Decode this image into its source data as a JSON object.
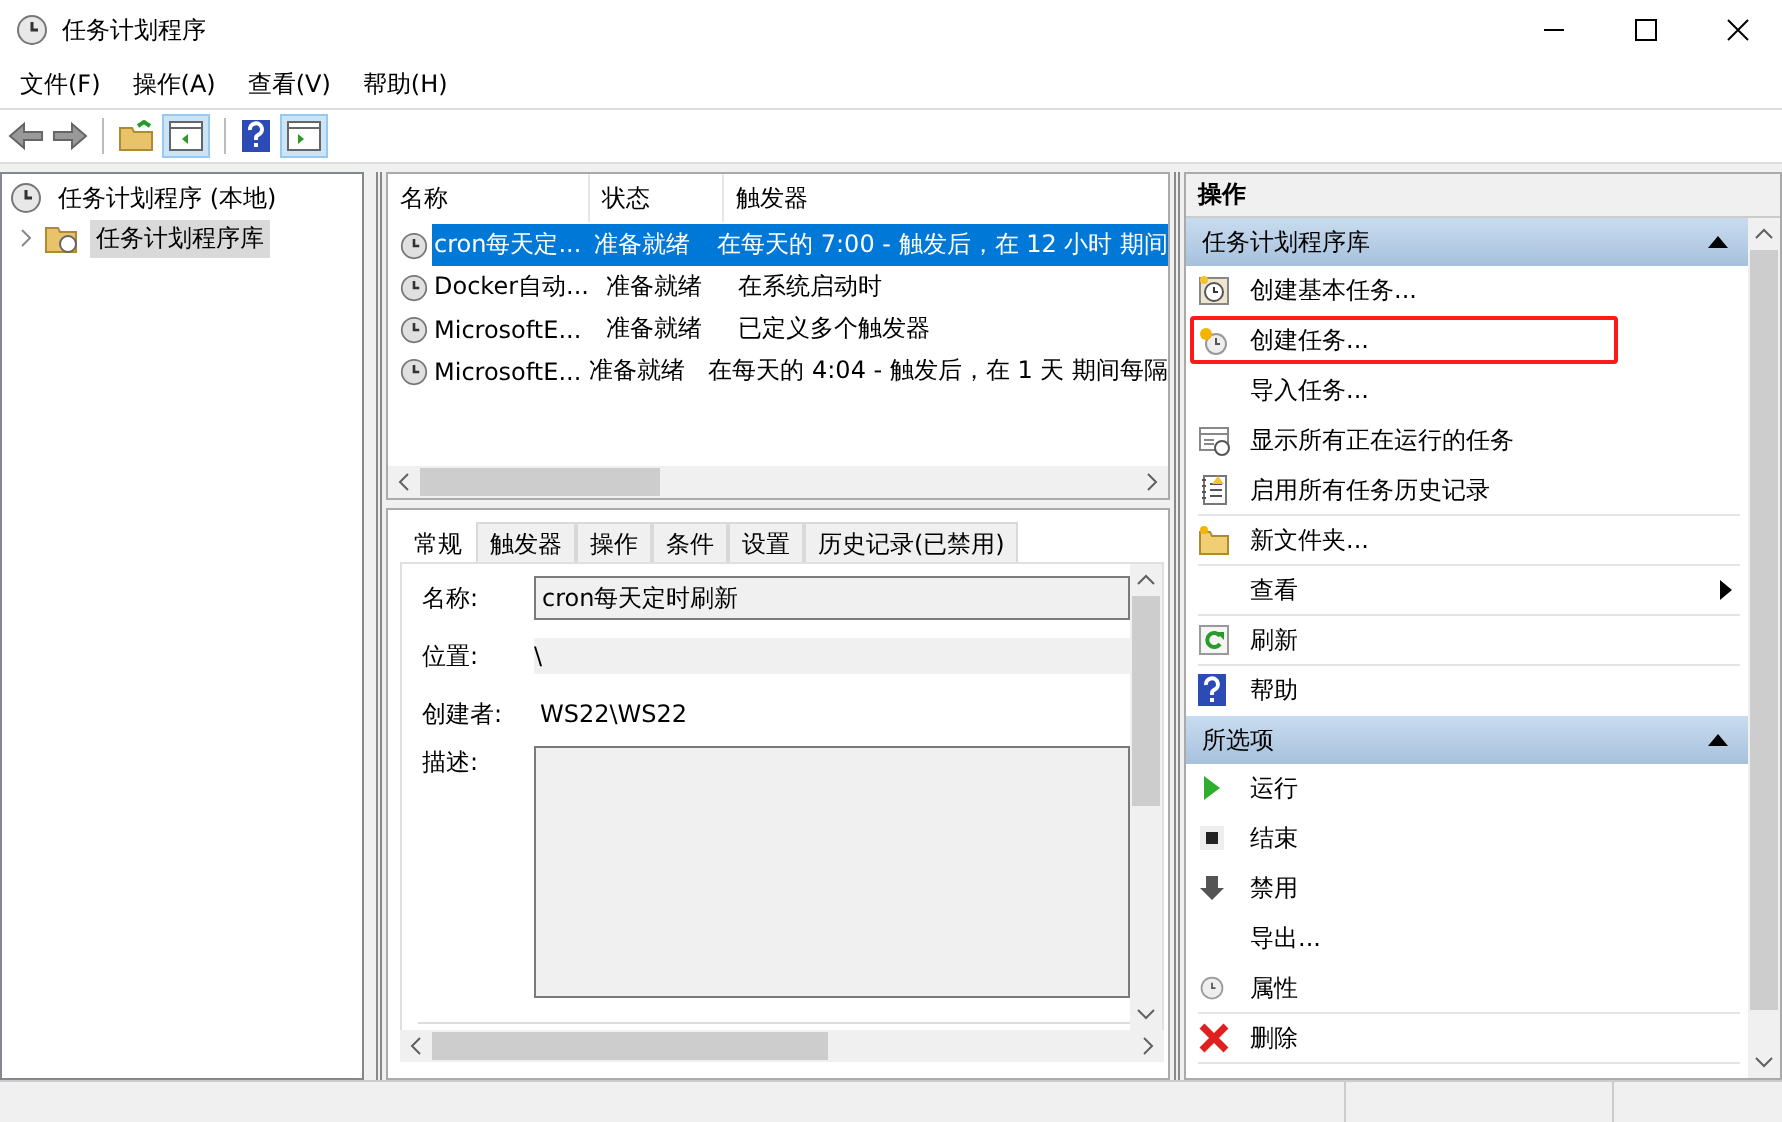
{
  "window": {
    "title": "任务计划程序"
  },
  "menu": [
    "文件(F)",
    "操作(A)",
    "查看(V)",
    "帮助(H)"
  ],
  "tree": {
    "label": "任务计划程序 (本地)",
    "children": [
      {
        "label": "任务计划程序库",
        "selected": true,
        "expanded": false
      }
    ]
  },
  "task_list": {
    "columns": [
      "名称",
      "状态",
      "触发器"
    ],
    "rows": [
      {
        "name": "cron每天定...",
        "status": "准备就绪",
        "trigger": "在每天的 7:00 - 触发后，在 12 小时 期间",
        "selected": true
      },
      {
        "name": "Docker自动...",
        "status": "准备就绪",
        "trigger": "在系统启动时",
        "selected": false
      },
      {
        "name": "MicrosoftE...",
        "status": "准备就绪",
        "trigger": "已定义多个触发器",
        "selected": false
      },
      {
        "name": "MicrosoftE...",
        "status": "准备就绪",
        "trigger": "在每天的 4:04 - 触发后，在 1 天 期间每隔",
        "selected": false
      }
    ]
  },
  "detail": {
    "tabs": [
      {
        "label": "常规",
        "selected": true
      },
      {
        "label": "触发器",
        "selected": false
      },
      {
        "label": "操作",
        "selected": false
      },
      {
        "label": "条件",
        "selected": false
      },
      {
        "label": "设置",
        "selected": false
      },
      {
        "label": "历史记录(已禁用)",
        "selected": false
      }
    ],
    "fields": [
      {
        "kind": "input",
        "label": "名称:",
        "value": "cron每天定时刷新"
      },
      {
        "kind": "readonly",
        "label": "位置:",
        "value": "\\"
      },
      {
        "kind": "text",
        "label": "创建者:",
        "value": "WS22\\WS22"
      },
      {
        "kind": "textarea",
        "label": "描述:"
      }
    ]
  },
  "actions": {
    "title": "操作",
    "sections": [
      {
        "title": "任务计划程序库",
        "expanded": true,
        "items": [
          {
            "kind": "basic",
            "label": "创建基本任务...",
            "annotated": false
          },
          {
            "kind": "create",
            "label": "创建任务...",
            "annotated": true
          },
          {
            "kind": "blank",
            "label": "导入任务...",
            "annotated": false
          },
          {
            "kind": "running",
            "label": "显示所有正在运行的任务",
            "annotated": false
          },
          {
            "kind": "history",
            "label": "启用所有任务历史记录",
            "annotated": false
          },
          {
            "kind": "folder",
            "label": "新文件夹...",
            "annotated": false
          },
          {
            "kind": "submenu",
            "label": "查看",
            "annotated": false
          },
          {
            "kind": "refresh",
            "label": "刷新",
            "annotated": false
          },
          {
            "kind": "help",
            "label": "帮助",
            "annotated": false
          }
        ]
      },
      {
        "title": "所选项",
        "expanded": true,
        "items": [
          {
            "kind": "run",
            "label": "运行",
            "annotated": false
          },
          {
            "kind": "stop",
            "label": "结束",
            "annotated": false
          },
          {
            "kind": "disable",
            "label": "禁用",
            "annotated": false
          },
          {
            "kind": "blank",
            "label": "导出...",
            "annotated": false
          },
          {
            "kind": "clock",
            "label": "属性",
            "annotated": false
          },
          {
            "kind": "delete",
            "label": "删除",
            "annotated": false
          }
        ]
      }
    ]
  }
}
